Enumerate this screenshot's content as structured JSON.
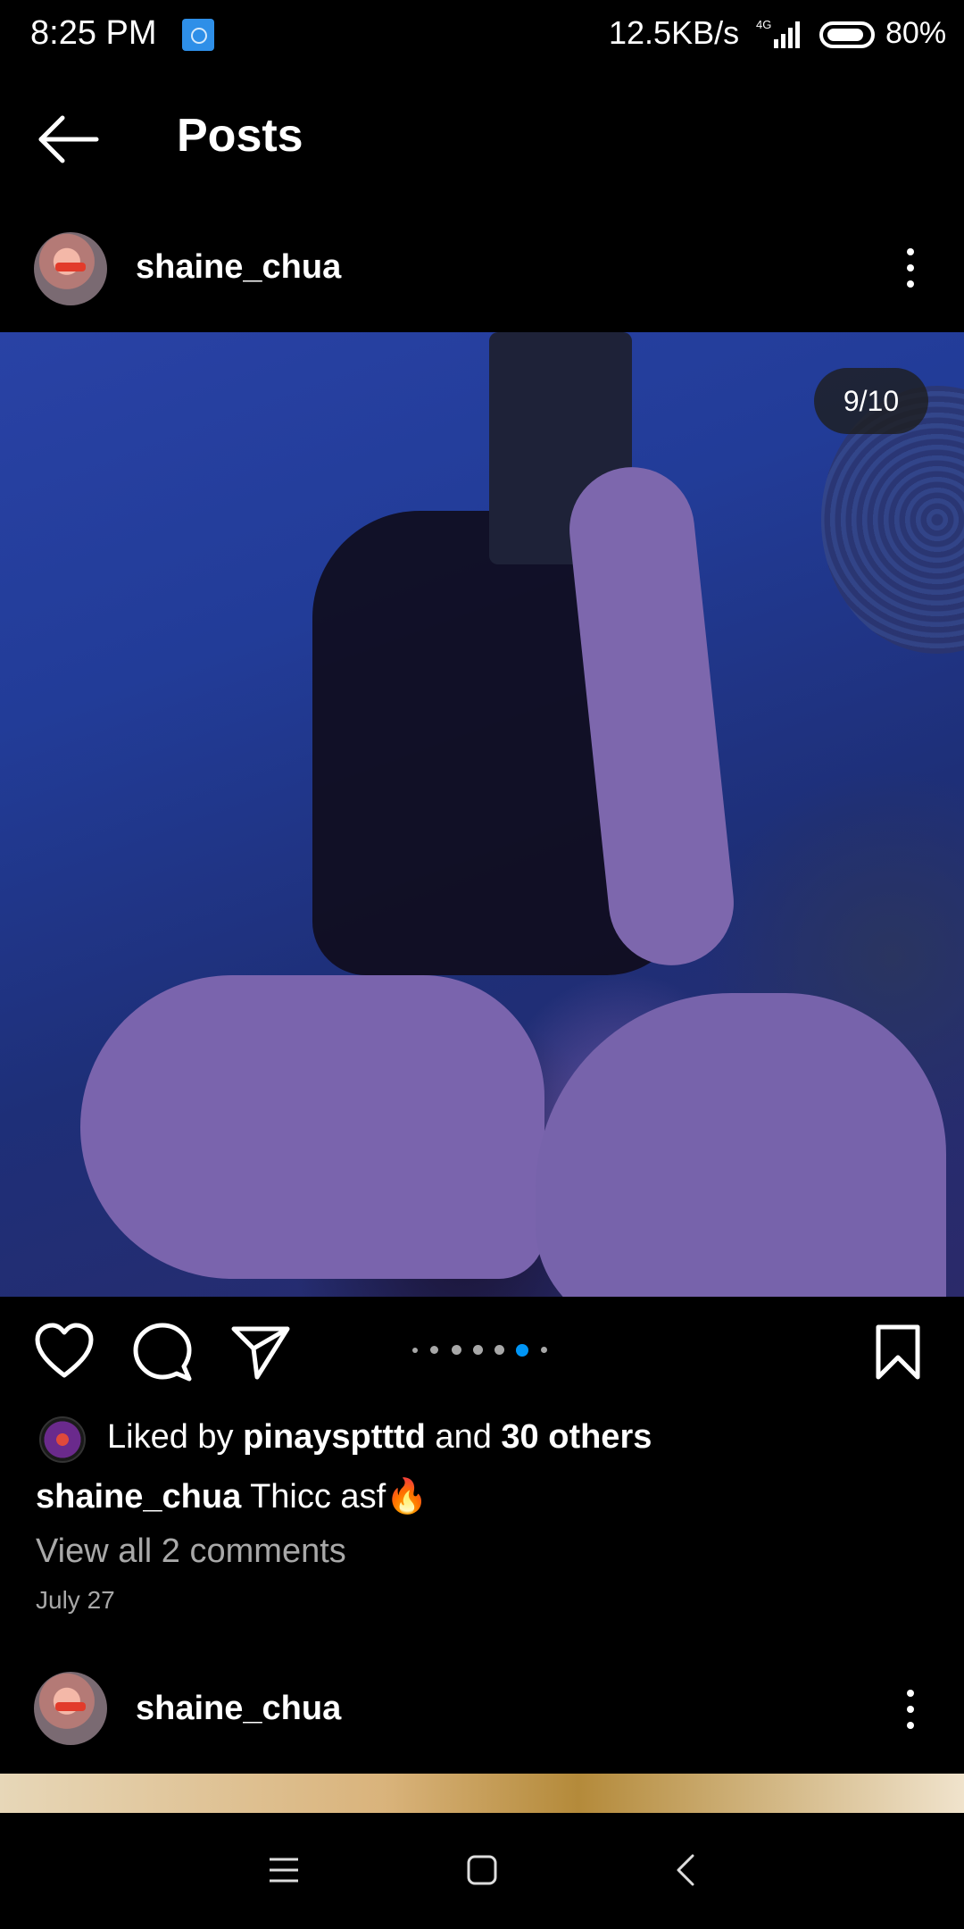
{
  "status_bar": {
    "time": "8:25 PM",
    "net_speed": "12.5KB/s",
    "network_type": "4G",
    "battery": "80%"
  },
  "header": {
    "title": "Posts",
    "back_icon": "arrow-left-icon"
  },
  "post": {
    "username": "shaine_chua",
    "image_counter": "9/10",
    "carousel": {
      "current_index": 5,
      "visible_dots": 7
    },
    "liked_by_prefix": "Liked by ",
    "liked_by_user": "pinaysptttd",
    "liked_by_and": " and ",
    "liked_by_others": "30 others",
    "caption_user": "shaine_chua",
    "caption_text": " Thicc asf🔥",
    "comments_link": "View all 2 comments",
    "date": "July 27"
  },
  "next_post": {
    "username": "shaine_chua"
  },
  "colors": {
    "background": "#000000",
    "text": "#ffffff",
    "secondary_text": "#a8a8a8",
    "accent_dot": "#0095f6"
  }
}
